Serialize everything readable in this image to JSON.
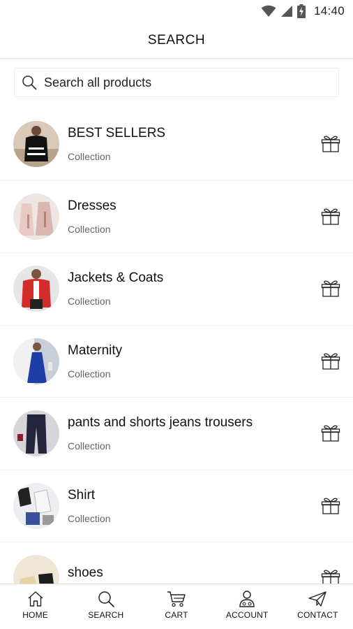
{
  "status_bar": {
    "time": "14:40",
    "icons": [
      "wifi-icon",
      "signal-icon",
      "battery-charging-icon"
    ]
  },
  "header": {
    "title": "SEARCH"
  },
  "search": {
    "placeholder": "Search all products",
    "icon": "search-icon"
  },
  "collections": [
    {
      "title": "BEST SELLERS",
      "subtitle": "Collection",
      "action_icon": "gift-icon"
    },
    {
      "title": "Dresses",
      "subtitle": "Collection",
      "action_icon": "gift-icon"
    },
    {
      "title": "Jackets & Coats",
      "subtitle": "Collection",
      "action_icon": "gift-icon"
    },
    {
      "title": "Maternity",
      "subtitle": "Collection",
      "action_icon": "gift-icon"
    },
    {
      "title": "pants and shorts jeans trousers",
      "subtitle": "Collection",
      "action_icon": "gift-icon"
    },
    {
      "title": "Shirt",
      "subtitle": "Collection",
      "action_icon": "gift-icon"
    },
    {
      "title": "shoes",
      "subtitle": "",
      "action_icon": "gift-icon"
    }
  ],
  "tab_bar": [
    {
      "label": "HOME",
      "icon": "home-icon"
    },
    {
      "label": "SEARCH",
      "icon": "search-icon"
    },
    {
      "label": "CART",
      "icon": "cart-icon"
    },
    {
      "label": "ACCOUNT",
      "icon": "account-icon"
    },
    {
      "label": "CONTACT",
      "icon": "paper-plane-icon"
    }
  ],
  "colors": {
    "background": "#ffffff",
    "text": "#111111",
    "subtext": "#666666",
    "divider": "#e4e4e4"
  }
}
